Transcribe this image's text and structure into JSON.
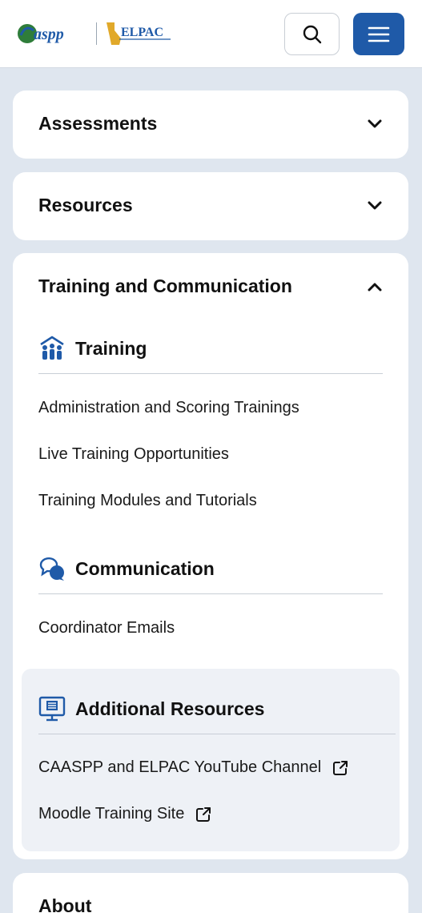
{
  "header": {
    "logo_primary": "CAASPP",
    "logo_secondary": "ELPAC",
    "search_icon": "search-icon",
    "menu_icon": "hamburger-menu-icon",
    "accent_color": "#1f5aa8"
  },
  "nav": {
    "assessments": {
      "label": "Assessments",
      "expanded": false
    },
    "resources": {
      "label": "Resources",
      "expanded": false
    },
    "training_communication": {
      "label": "Training and Communication",
      "expanded": true,
      "training": {
        "title": "Training",
        "icon": "group-people-icon",
        "links": [
          "Administration and Scoring Trainings",
          "Live Training Opportunities",
          "Training Modules and Tutorials"
        ]
      },
      "communication": {
        "title": "Communication",
        "icon": "chat-bubbles-icon",
        "links": [
          "Coordinator Emails"
        ]
      },
      "additional_resources": {
        "title": "Additional Resources",
        "icon": "presentation-board-icon",
        "links": [
          {
            "label": "CAASPP and ELPAC YouTube Channel",
            "external": true
          },
          {
            "label": "Moodle Training Site",
            "external": true
          }
        ]
      }
    },
    "about": {
      "label": "About"
    }
  }
}
